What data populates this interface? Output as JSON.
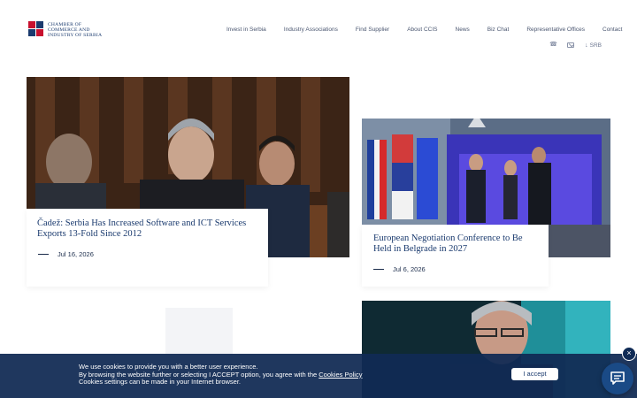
{
  "header": {
    "logo_lines": [
      "CHAMBER OF",
      "COMMERCE AND",
      "INDUSTRY OF SERBIA"
    ],
    "nav": [
      {
        "label": "Invest in Serbia"
      },
      {
        "label": "Industry Associations"
      },
      {
        "label": "Find Supplier"
      },
      {
        "label": "About CCIS"
      },
      {
        "label": "News"
      },
      {
        "label": "Biz Chat"
      },
      {
        "label": "Representative Offices"
      },
      {
        "label": "Contact"
      }
    ],
    "language": "SRB"
  },
  "news": [
    {
      "title": "Čadež: Serbia Has Increased Software and ICT Services Exports 13-Fold Since 2012",
      "date": "Jul 16, 2026"
    },
    {
      "title": "European Negotiation Conference to Be Held in Belgrade in 2027",
      "date": "Jul 6, 2026"
    }
  ],
  "cookie": {
    "line1": "We use cookies to provide you with a better user experience.",
    "line2_prefix": "By browsing the website further or selecting I ACCEPT option, you agree with the ",
    "link": "Cookies Policy",
    "line3": "Cookies settings can be made in your Internet browser.",
    "accept_label": "I accept",
    "close_label": "×"
  },
  "colors": {
    "brand_navy": "#1a3a6e",
    "brand_red": "#c8102e",
    "banner": "#112a54"
  }
}
